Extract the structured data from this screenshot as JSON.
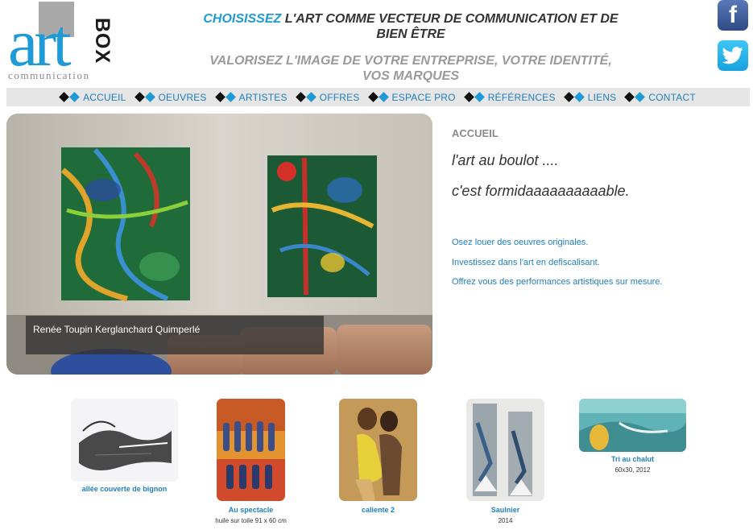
{
  "logo": {
    "main": "art",
    "side": "BOX",
    "sub": "communication"
  },
  "header": {
    "tagline_accent": "CHOISISSEZ",
    "tagline_rest_1": " L'ART COMME VECTEUR DE COMMUNICATION ET DE",
    "tagline_rest_2": "BIEN ÊTRE",
    "subline_1": "VALORISEZ L'IMAGE DE VOTRE ENTREPRISE, VOTRE IDENTITÉ,",
    "subline_2": "VOS MARQUES"
  },
  "social": {
    "facebook_icon": "facebook-icon",
    "twitter_icon": "twitter-icon"
  },
  "nav": {
    "items": [
      {
        "label": "ACCUEIL"
      },
      {
        "label": "OEUVRES"
      },
      {
        "label": "ARTISTES"
      },
      {
        "label": "OFFRES"
      },
      {
        "label": "ESPACE PRO"
      },
      {
        "label": "RÉFÉRENCES"
      },
      {
        "label": "LIENS"
      },
      {
        "label": "CONTACT"
      }
    ]
  },
  "hero": {
    "caption": "Renée Toupin Kerglanchard Quimperlé"
  },
  "main": {
    "heading": "ACCUEIL",
    "line1": "l'art au boulot ....",
    "line2": "c'est formidaaaaaaaaaable.",
    "links": [
      "Osez louer des oeuvres originales.",
      "Investissez dans l'art en defiscalisant.",
      "Offrez vous des performances artistiques sur mesure."
    ]
  },
  "thumbnails": [
    {
      "title": "allée couverte de bignon",
      "subtitle": ""
    },
    {
      "title": "Au spectacle",
      "subtitle": "huile sur toile 91 x 60 cm"
    },
    {
      "title": "caliente 2",
      "subtitle": ""
    },
    {
      "title": "Saulnier",
      "subtitle": "2014"
    },
    {
      "title": "Tri au chalut",
      "subtitle": "60x30, 2012"
    }
  ],
  "colors": {
    "accent": "#1e9ad6",
    "link": "#1e7fc0",
    "nav_bg": "#e6e6e6"
  }
}
